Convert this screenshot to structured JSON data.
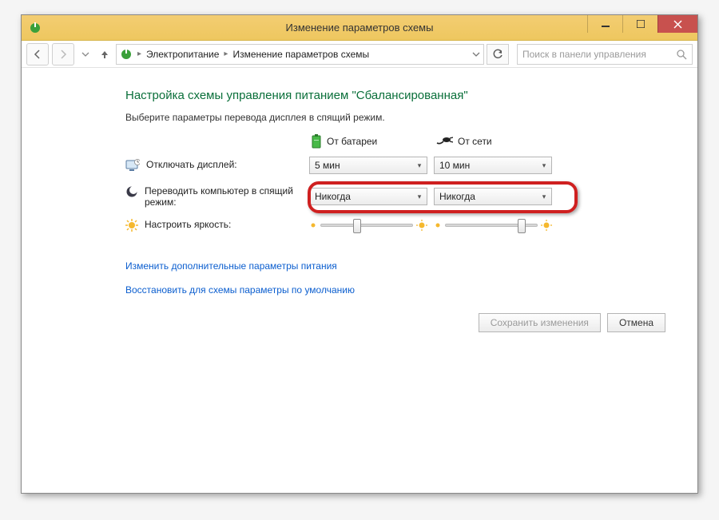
{
  "window": {
    "title": "Изменение параметров схемы"
  },
  "nav": {
    "crumb1": "Электропитание",
    "crumb2": "Изменение параметров схемы",
    "search_placeholder": "Поиск в панели управления"
  },
  "main": {
    "heading": "Настройка схемы управления питанием \"Сбалансированная\"",
    "subheading": "Выберите параметры перевода дисплея в спящий режим.",
    "col_battery": "От батареи",
    "col_mains": "От сети",
    "rows": {
      "display_off": {
        "label": "Отключать дисплей:",
        "battery_value": "5 мин",
        "mains_value": "10 мин"
      },
      "sleep": {
        "label": "Переводить компьютер в спящий режим:",
        "battery_value": "Никогда",
        "mains_value": "Никогда"
      },
      "brightness": {
        "label": "Настроить яркость:"
      }
    },
    "link_advanced": "Изменить дополнительные параметры питания",
    "link_restore": "Восстановить для схемы параметры по умолчанию",
    "btn_save": "Сохранить изменения",
    "btn_cancel": "Отмена"
  }
}
